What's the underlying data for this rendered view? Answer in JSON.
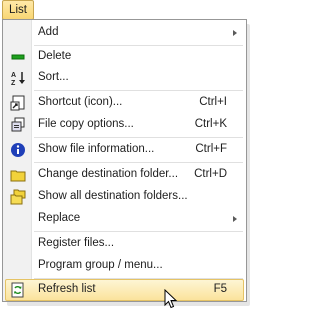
{
  "menubar": {
    "list_label": "List"
  },
  "menu": {
    "items": [
      {
        "label": "Add",
        "shortcut": "",
        "submenu": true,
        "icon": ""
      },
      {
        "label": "Delete",
        "shortcut": "",
        "submenu": false,
        "icon": "minus-icon"
      },
      {
        "label": "Sort...",
        "shortcut": "",
        "submenu": false,
        "icon": "sort-az-icon"
      },
      {
        "label": "Shortcut (icon)...",
        "shortcut": "Ctrl+I",
        "submenu": false,
        "icon": "shortcut-icon"
      },
      {
        "label": "File copy options...",
        "shortcut": "Ctrl+K",
        "submenu": false,
        "icon": "copy-options-icon"
      },
      {
        "label": "Show file information...",
        "shortcut": "Ctrl+F",
        "submenu": false,
        "icon": "info-icon"
      },
      {
        "label": "Change destination folder...",
        "shortcut": "Ctrl+D",
        "submenu": false,
        "icon": "folder-icon"
      },
      {
        "label": "Show all destination folders...",
        "shortcut": "",
        "submenu": false,
        "icon": "folders-icon"
      },
      {
        "label": "Replace",
        "shortcut": "",
        "submenu": true,
        "icon": ""
      },
      {
        "label": "Register files...",
        "shortcut": "",
        "submenu": false,
        "icon": ""
      },
      {
        "label": "Program group / menu...",
        "shortcut": "",
        "submenu": false,
        "icon": ""
      },
      {
        "label": "Refresh list",
        "shortcut": "F5",
        "submenu": false,
        "icon": "refresh-icon",
        "highlighted": true
      }
    ]
  },
  "colors": {
    "highlight": "#fbe39c",
    "accent": "#c8a64f"
  }
}
